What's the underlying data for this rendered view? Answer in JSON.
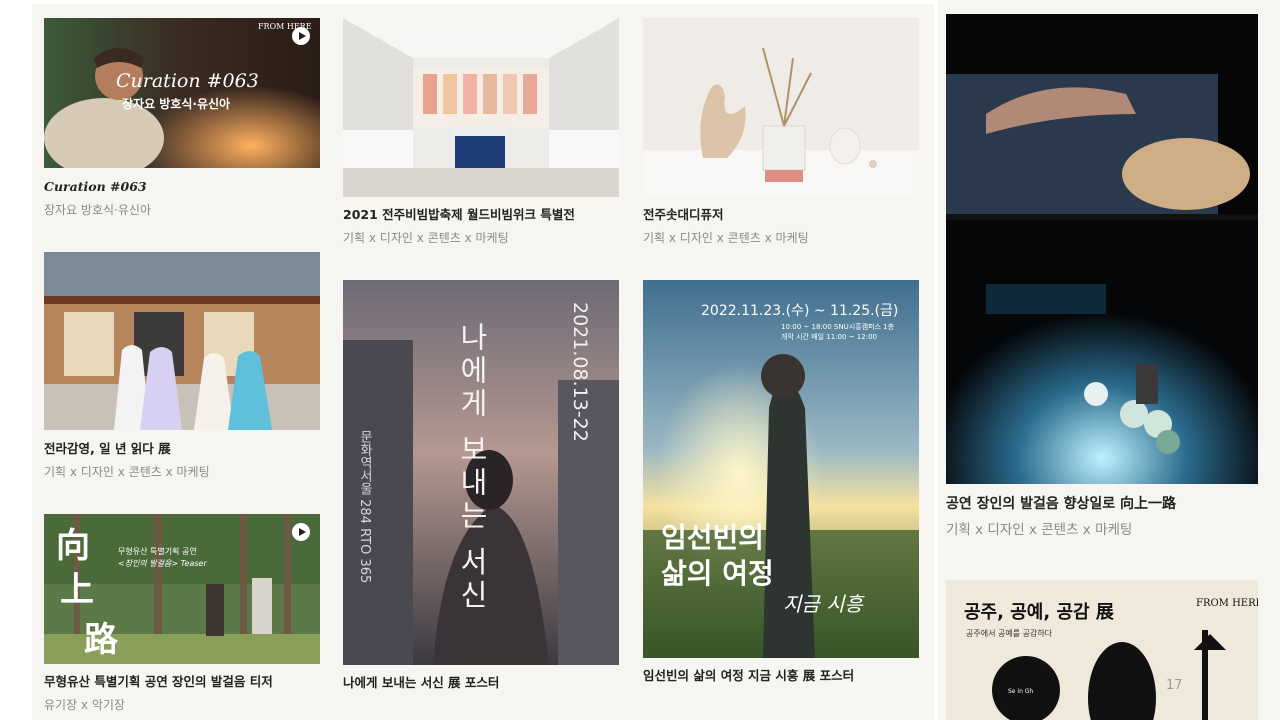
{
  "cards": [
    {
      "title": "Curation #063",
      "subtitle": "장자요 방호식·유신아",
      "overlay_title": "Curation #063",
      "overlay_sub": "장자요 방호식·유신아",
      "logo": "FROM HERE",
      "play_icon": "play-icon"
    },
    {
      "title": "2021 전주비빔밥축제 월드비빔위크 특별전",
      "subtitle": "기획 x 디자인 x 콘텐츠 x 마케팅"
    },
    {
      "title": "전주솟대디퓨저",
      "subtitle": "기획 x 디자인 x 콘텐츠 x 마케팅"
    },
    {
      "title": "전라감영, 일 년 읽다 展",
      "subtitle": "기획 x 디자인 x 콘텐츠 x 마케팅"
    },
    {
      "title": "나에게 보내는 서신 展 포스터",
      "subtitle": "",
      "poster_title": "나에게 보내는 서신",
      "poster_date": "2021.08.13-22",
      "poster_side": "문화역서울 284 RTO 365"
    },
    {
      "title": "임선빈의 삶의 여정 지금 시흥 展 포스터",
      "subtitle": "",
      "poster_date": "2022.11.23.(수) ~ 11.25.(금)",
      "poster_info_1": "10:00 ~ 18:00   SNU시흥캠퍼스 1층",
      "poster_info_2": "개막 시간   매일 11:00 ~ 12:00",
      "poster_title_1": "임선빈의",
      "poster_title_2": "삶의 여정",
      "poster_script": "지금 시흥"
    },
    {
      "title": "무형유산 특별기획 공연 장인의 발걸음 티저",
      "subtitle": "유기장 x 악기장",
      "poster_han_1": "向",
      "poster_han_2": "上",
      "poster_han_3": "路",
      "poster_caption_1": "무형유산 특별기획 공연",
      "poster_caption_2": "<장인의 발걸음> Teaser",
      "play_icon": "play-icon"
    },
    {
      "title": "공연 장인의 발걸음 향상일로 向上一路",
      "subtitle": "기획 x 디자인 x 콘텐츠 x 마케팅"
    },
    {
      "title": "",
      "subtitle": "",
      "poster_title": "공주, 공예, 공감 展",
      "poster_caption": "공주에서 공예를 공감하다",
      "logo": "FROM HERE",
      "poster_small": "Se in Gh"
    }
  ],
  "page_number": "17",
  "colors": {
    "background": "#f7f5f2",
    "title": "#222222",
    "subtitle": "#8a8a8a"
  }
}
